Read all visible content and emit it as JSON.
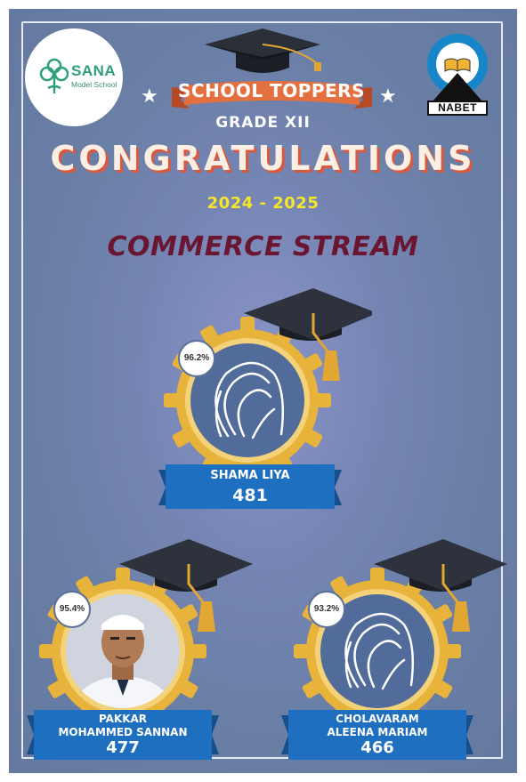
{
  "school": {
    "name": "SANA",
    "subtitle": "Model School"
  },
  "accreditation": {
    "name": "NABET"
  },
  "header": {
    "ribbon": "SCHOOL TOPPERS",
    "grade": "GRADE XII",
    "headline": "CONGRATULATIONS",
    "year": "2024 - 2025",
    "stream": "COMMERCE STREAM"
  },
  "toppers": [
    {
      "name_line1": "SHAMA LIYA",
      "name_line2": "",
      "marks": "481",
      "percent": "96.2%",
      "photo": "hijab-silhouette-icon"
    },
    {
      "name_line1": "PAKKAR",
      "name_line2": "MOHAMMED SANNAN",
      "marks": "477",
      "percent": "95.4%",
      "photo": "student-portrait"
    },
    {
      "name_line1": "CHOLAVARAM",
      "name_line2": "ALEENA MARIAM",
      "marks": "466",
      "percent": "93.2%",
      "photo": "hijab-silhouette-icon"
    }
  ],
  "colors": {
    "background": "#6f80ac",
    "gold": "#e7b33b",
    "banner_blue": "#1f6fc0",
    "headline_shadow": "#d9593f",
    "year_yellow": "#f5e62c",
    "stream_maroon": "#6a1631",
    "ribbon_orange": "#e4703f",
    "logo_green": "#2fa079"
  }
}
